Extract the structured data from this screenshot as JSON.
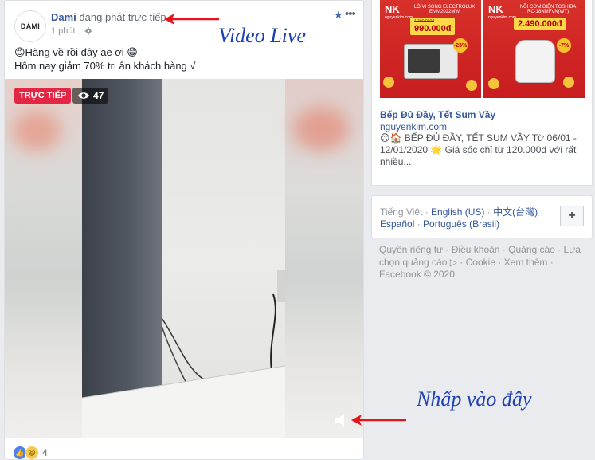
{
  "post": {
    "avatar_text": "DAMI",
    "page_name": "Dami",
    "action": " đang phát trực tiếp.",
    "time": "1 phút",
    "privacy_dot": "·",
    "more": "•••",
    "caption_line1": "😊Hàng về rồi đây ae ơi 😁",
    "caption_line2": "Hôm nay giảm 70% tri ân khách hàng √",
    "live_badge": "TRỰC TIẾP",
    "viewer_count": "47",
    "reaction_count": "4"
  },
  "annotations": {
    "video_live": "Video Live",
    "click_here": "Nhấp vào đây"
  },
  "ad": {
    "left_brand": "NK",
    "left_brand_sub": "nguyenkim.com",
    "left_product": "LÒ VI SÓNG ELECTROLUX",
    "left_model": "EMM2022MW",
    "left_old_price": "1.390.000đ",
    "left_price": "990.000đ",
    "left_discount": "-23%",
    "right_brand": "NK",
    "right_brand_sub": "nguyenkim.com",
    "right_product": "NỒI CƠM ĐIỆN TOSHIBA",
    "right_model": "RC-18NMFVN(WT)",
    "right_price": "2.490.000đ",
    "right_discount": "-7%",
    "title": "Bếp Đủ Đầy, Tết Sum Vầy",
    "domain": "nguyenkim.com",
    "text": "😊🏠 BẾP ĐỦ ĐẦY, TẾT SUM VẦY Từ 06/01 - 12/01/2020 🌟 Giá sốc chỉ từ 120.000đ với rất nhiều..."
  },
  "languages": {
    "current": "Tiếng Việt",
    "sep": " · ",
    "options": [
      "English (US)",
      "中文(台灣)",
      "Español",
      "Português (Brasil)"
    ],
    "plus": "+"
  },
  "footer": {
    "links": [
      "Quyền riêng tư",
      "Điều khoản",
      "Quảng cáo",
      "Lựa chọn quảng cáo ▷",
      "Cookie",
      "Xem thêm"
    ],
    "copyright": "Facebook © 2020"
  },
  "colors": {
    "fb_link": "#365899",
    "live_red": "#e42645",
    "annotation_blue": "#1f3fb5",
    "arrow_red": "#e8141c"
  }
}
